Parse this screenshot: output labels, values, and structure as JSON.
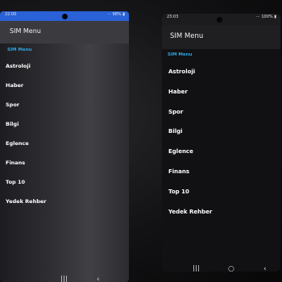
{
  "left_phone": {
    "status": {
      "time": "22:00",
      "indicators": "⋯ 98% ▮"
    },
    "title": "SIM Menu",
    "section_header": "SIM Menu",
    "items": [
      "Astroloji",
      "Haber",
      "Spor",
      "Bilgi",
      "Eglence",
      "Finans",
      "Top 10",
      "Yedek Rehber"
    ],
    "nav": {
      "recent": "|||",
      "back": "‹"
    }
  },
  "right_phone": {
    "status": {
      "time": "23:03",
      "indicators": "⋯ 100% ▮"
    },
    "title": "SIM Menu",
    "section_header": "SIM Menu",
    "items": [
      "Astroloji",
      "Haber",
      "Spor",
      "Bilgi",
      "Eglence",
      "Finans",
      "Top 10",
      "Yedek Rehber"
    ],
    "nav": {
      "recent": "|||",
      "home": "○",
      "back": "‹"
    }
  },
  "colors": {
    "header_accent": "#2aa7e8",
    "text": "#ffffff"
  }
}
